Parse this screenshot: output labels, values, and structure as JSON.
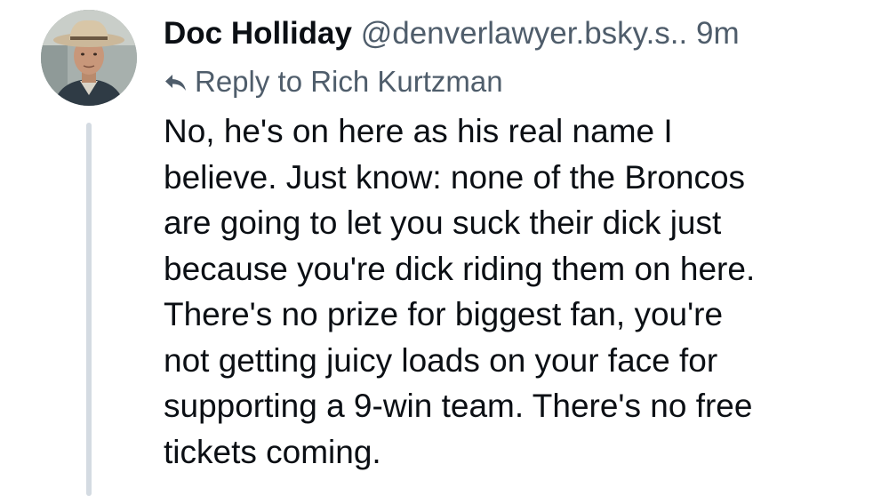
{
  "post": {
    "author": {
      "display_name": "Doc Holliday",
      "handle": "@denverlawyer.bsky.s..",
      "avatar_icon": "avatar-photo-cowboy-hat"
    },
    "timestamp": "9m",
    "reply_to": {
      "label": "Reply to Rich Kurtzman",
      "icon": "reply-arrow-icon"
    },
    "text_lines": [
      "No, he's on here as his real name I",
      "believe. Just know: none of the Broncos",
      "are going to let you suck their dick just",
      "because you're dick riding them on here.",
      "There's no prize for biggest fan, you're",
      "not getting juicy loads on your face for",
      "supporting a 9-win team. There's no free",
      "tickets coming."
    ]
  },
  "colors": {
    "text_primary": "#0b0f14",
    "text_secondary": "#4f5d6b",
    "thread_line": "#d4dbe2",
    "background": "#ffffff"
  }
}
